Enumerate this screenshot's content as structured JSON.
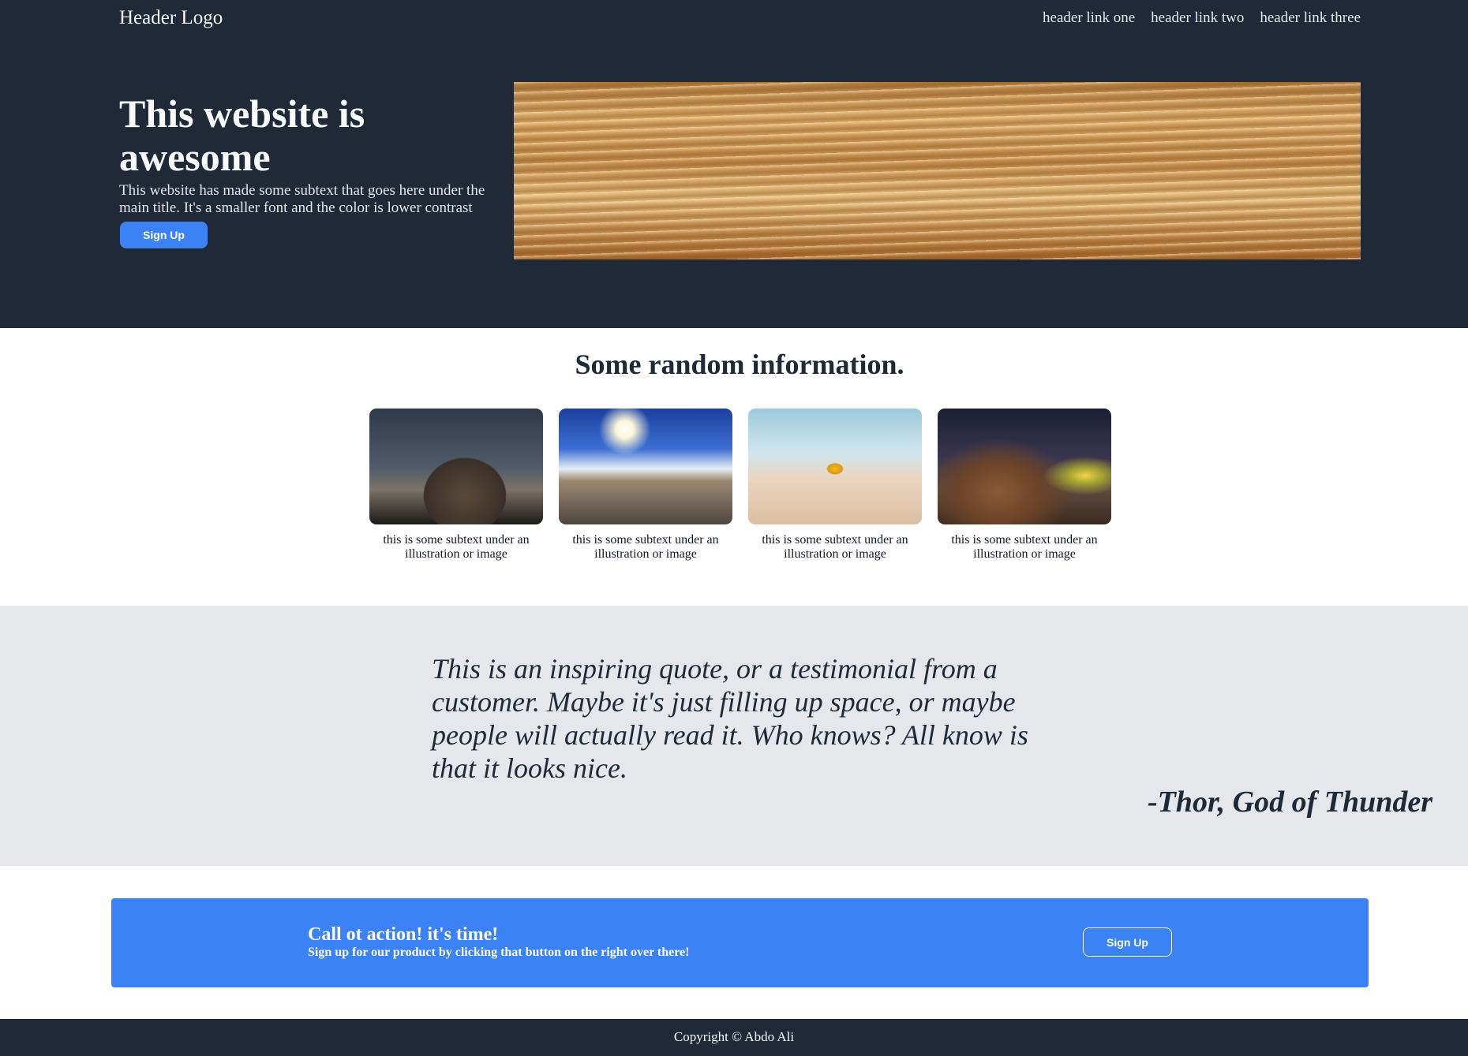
{
  "header": {
    "logo": "Header Logo",
    "links": [
      "header link one",
      "header link two",
      "header link three"
    ]
  },
  "hero": {
    "title": "This website is awesome",
    "subtitle": "This website has made some subtext that goes here under the main title. It's a smaller font and the color is lower contrast",
    "button_label": "Sign Up"
  },
  "info": {
    "title": "Some random information.",
    "cards": [
      {
        "text": "this is some subtext under an illustration or image"
      },
      {
        "text": "this is some subtext under an illustration or image"
      },
      {
        "text": "this is some subtext under an illustration or image"
      },
      {
        "text": "this is some subtext under an illustration or image"
      }
    ]
  },
  "quote": {
    "text": "This is an inspiring quote, or a testimonial from a customer. Maybe it's just filling up space, or maybe people will actually read it. Who knows? All know is that it looks nice.",
    "author": "-Thor, God of Thunder"
  },
  "cta": {
    "title": "Call ot action! it's time!",
    "subtitle": "Sign up for our product by clicking that button on the right over there!",
    "button_label": "Sign Up"
  },
  "footer": {
    "copyright": "Copyright © Abdo Ali"
  },
  "colors": {
    "dark": "#1f2937",
    "accent": "#3b82f6",
    "light_band": "#e5e7eb"
  }
}
